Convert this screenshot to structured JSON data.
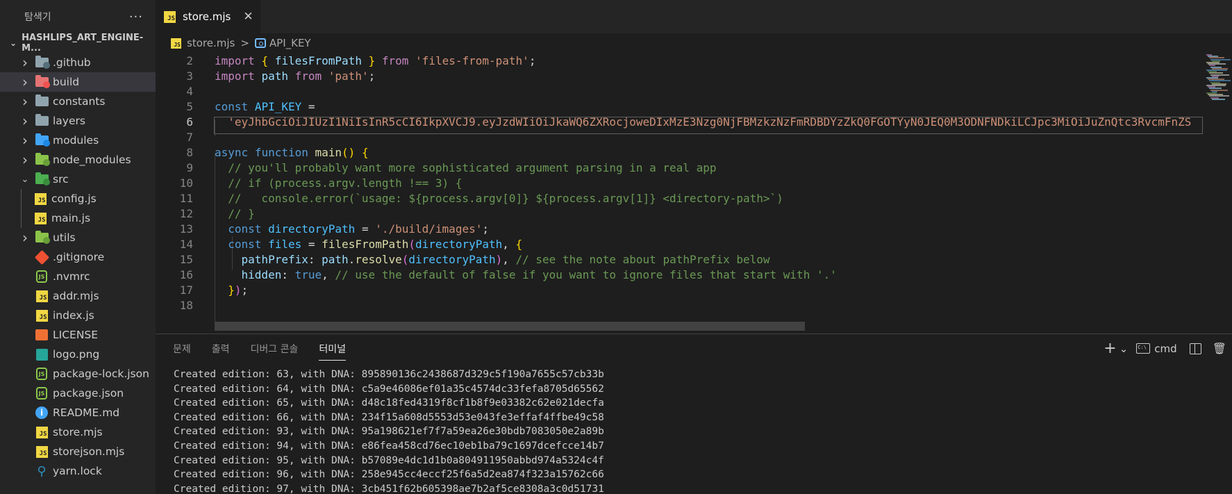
{
  "sidebar": {
    "title": "탐색기",
    "more": "···",
    "root_folder": "HASHLIPS_ART_ENGINE-M...",
    "items": [
      {
        "label": ".github",
        "kind": "folder",
        "color": "#90a4ae",
        "badge": "#546e7a"
      },
      {
        "label": "build",
        "kind": "folder",
        "color": "#e57373",
        "badge": "#ef5350"
      },
      {
        "label": "constants",
        "kind": "folder",
        "color": "#90a4ae"
      },
      {
        "label": "layers",
        "kind": "folder",
        "color": "#90a4ae"
      },
      {
        "label": "modules",
        "kind": "folder",
        "color": "#42a5f5",
        "badge": "#1e88e5"
      },
      {
        "label": "node_modules",
        "kind": "folder",
        "color": "#8bc34a",
        "badge": "#689f38"
      },
      {
        "label": "src",
        "kind": "folder-open",
        "color": "#4caf50",
        "badge": "#388e3c"
      },
      {
        "label": "config.js",
        "kind": "js"
      },
      {
        "label": "main.js",
        "kind": "js"
      },
      {
        "label": "utils",
        "kind": "folder",
        "color": "#8bc34a",
        "badge": "#689f38"
      },
      {
        "label": ".gitignore",
        "kind": "git"
      },
      {
        "label": ".nvmrc",
        "kind": "node"
      },
      {
        "label": "addr.mjs",
        "kind": "js"
      },
      {
        "label": "index.js",
        "kind": "js"
      },
      {
        "label": "LICENSE",
        "kind": "license"
      },
      {
        "label": "logo.png",
        "kind": "image"
      },
      {
        "label": "package-lock.json",
        "kind": "node"
      },
      {
        "label": "package.json",
        "kind": "node"
      },
      {
        "label": "README.md",
        "kind": "info"
      },
      {
        "label": "store.mjs",
        "kind": "js"
      },
      {
        "label": "storejson.mjs",
        "kind": "js"
      },
      {
        "label": "yarn.lock",
        "kind": "yarn"
      }
    ]
  },
  "tabs": {
    "active_label": "store.mjs",
    "close": "✕",
    "icon_text": "JS"
  },
  "breadcrumb": {
    "file": "store.mjs",
    "separator": ">",
    "symbol": "API_KEY"
  },
  "editor": {
    "line_numbers": [
      "2",
      "3",
      "4",
      "5",
      "6",
      "7",
      "8",
      "9",
      "10",
      "11",
      "12",
      "13",
      "14",
      "15",
      "16",
      "17",
      "18"
    ],
    "active_line": "6"
  },
  "panel": {
    "tabs": [
      "문제",
      "출력",
      "디버그 콘솔",
      "터미널"
    ],
    "active_tab": "터미널",
    "actions": {
      "add": "+",
      "dropdown": "⌄",
      "shell": "cmd",
      "trash": "🗑"
    },
    "terminal_lines": [
      "Created edition: 63, with DNA: 895890136c2438687d329c5f190a7655c57cb33b",
      "Created edition: 64, with DNA: c5a9e46086ef01a35c4574dc33fefa8705d65562",
      "Created edition: 65, with DNA: d48c18fed4319f8cf1b8f9e03382c62e021decfa",
      "Created edition: 66, with DNA: 234f15a608d5553d53e043fe3effaf4ffbe49c58",
      "Created edition: 93, with DNA: 95a198621ef7f7a59ea26e30bdb7083050e2a89b",
      "Created edition: 94, with DNA: e86fea458cd76ec10eb1ba79c1697dcefcce14b7",
      "Created edition: 95, with DNA: b57089e4dc1d1b0a804911950abbd974a5324c4f",
      "Created edition: 96, with DNA: 258e945cc4eccf25f6a5d2ea874f323a15762c66",
      "Created edition: 97, with DNA: 3cb451f62b605398ae7b2af5ce8308a3c0d51731"
    ]
  },
  "colors": {
    "editor_bg": "#1e1e1e",
    "sidebar_bg": "#252526",
    "selected_row": "#37373d",
    "keyword": "#c586c0",
    "string": "#ce9178",
    "comment": "#6a9955"
  }
}
